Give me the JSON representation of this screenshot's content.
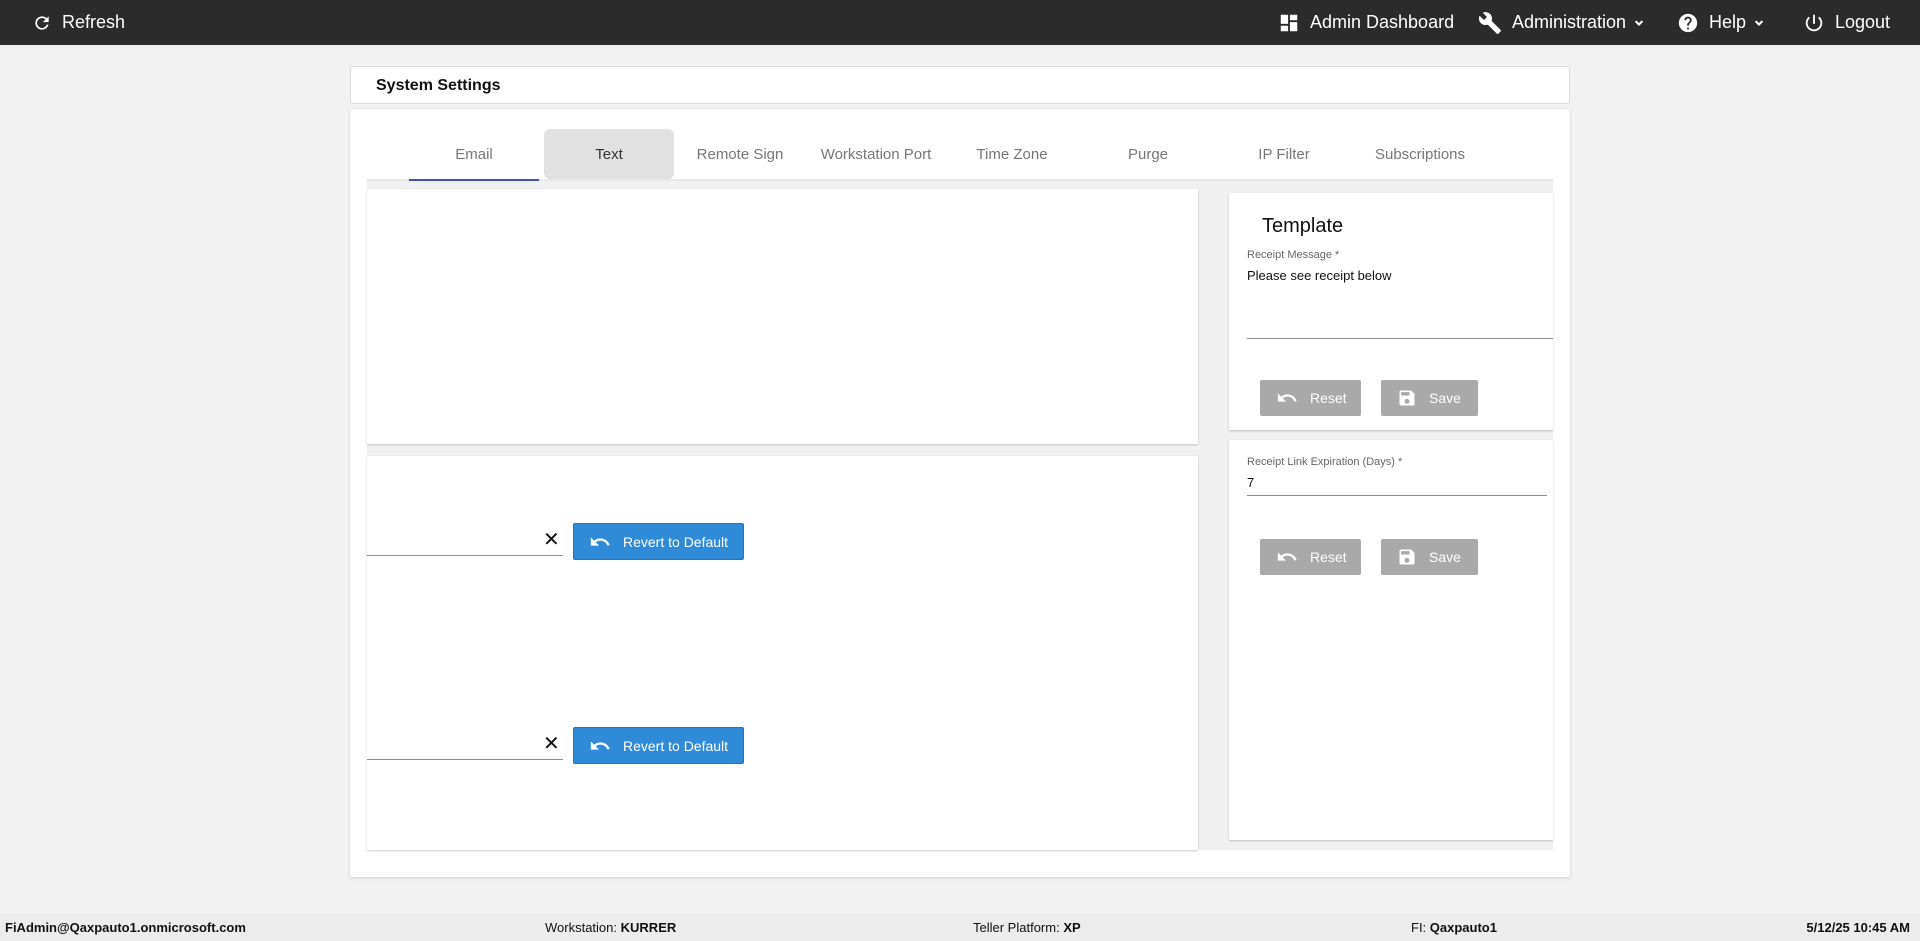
{
  "topbar": {
    "refresh_label": "Refresh",
    "admin_dashboard_label": "Admin Dashboard",
    "administration_label": "Administration",
    "help_label": "Help",
    "logout_label": "Logout"
  },
  "page": {
    "title": "System Settings"
  },
  "tabs": [
    {
      "label": "Email"
    },
    {
      "label": "Text"
    },
    {
      "label": "Remote Sign"
    },
    {
      "label": "Workstation Port"
    },
    {
      "label": "Time Zone"
    },
    {
      "label": "Purge"
    },
    {
      "label": "IP Filter"
    },
    {
      "label": "Subscriptions"
    }
  ],
  "left_panel": {
    "revert_label_1": "Revert to Default",
    "revert_label_2": "Revert to Default"
  },
  "template_panel": {
    "title": "Template",
    "receipt_message_label": "Receipt Message *",
    "receipt_message_value": "Please see receipt below",
    "reset_label": "Reset",
    "save_label": "Save"
  },
  "expiration_panel": {
    "label": "Receipt Link Expiration (Days) *",
    "value": "7",
    "reset_label": "Reset",
    "save_label": "Save"
  },
  "statusbar": {
    "user": "FiAdmin@Qaxpauto1.onmicrosoft.com",
    "workstation_label": "Workstation:",
    "workstation_value": "KURRER",
    "teller_label": "Teller Platform:",
    "teller_value": "XP",
    "fi_label": "FI:",
    "fi_value": "Qaxpauto1",
    "datetime": "5/12/25 10:45 AM"
  },
  "colors": {
    "topbar": "#2b2b2b",
    "active_tab_underline": "#3f51b5",
    "primary_button": "#2f8ad8",
    "disabled_button": "#a9a9a9"
  }
}
